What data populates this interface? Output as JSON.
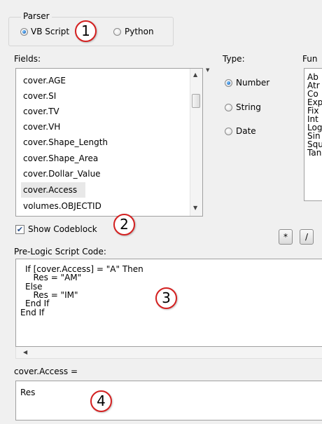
{
  "parser": {
    "legend": "Parser",
    "options": [
      {
        "label": "VB Script",
        "checked": true
      },
      {
        "label": "Python",
        "checked": false
      }
    ]
  },
  "fields": {
    "label": "Fields:",
    "items": [
      "cover.AGE",
      "cover.SI",
      "cover.TV",
      "cover.VH",
      "cover.Shape_Length",
      "cover.Shape_Area",
      "cover.Dollar_Value",
      "cover.Access",
      "volumes.OBJECTID"
    ],
    "selected": "cover.Access"
  },
  "type": {
    "label": "Type:",
    "options": [
      {
        "label": "Number",
        "checked": true
      },
      {
        "label": "String",
        "checked": false
      },
      {
        "label": "Date",
        "checked": false
      }
    ]
  },
  "functions": {
    "label": "Fun",
    "items": [
      "Ab",
      "Atr",
      "Co",
      "Exp",
      "Fix",
      "Int",
      "Log",
      "Sin",
      "Squ",
      "Tan"
    ]
  },
  "show_codeblock": {
    "label": "Show Codeblock",
    "checked": true
  },
  "operators": [
    "*",
    "/"
  ],
  "prelogic": {
    "label": "Pre-Logic Script Code:",
    "lines": [
      "If [cover.Access] = \"A\" Then",
      "   Res = \"AM\"",
      "Else",
      "   Res = \"IM\"",
      "End If",
      "End If"
    ]
  },
  "expression": {
    "label": "cover.Access =",
    "value": "Res"
  },
  "callouts": [
    "1",
    "2",
    "3",
    "4"
  ],
  "colors": {
    "callout_border": "#d42020",
    "window_bg": "#f0f0f0"
  }
}
